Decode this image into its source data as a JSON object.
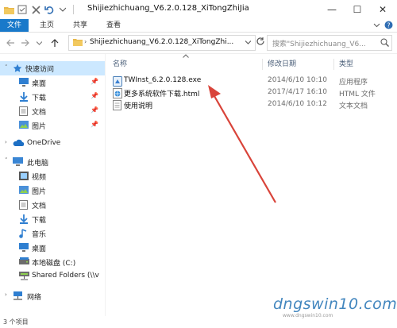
{
  "window": {
    "title": "Shijiezhichuang_V6.2.0.128_XiTongZhiJia",
    "controls": {
      "minimize": "—",
      "maximize": "☐",
      "close": "✕"
    }
  },
  "ribbon": {
    "tabs": [
      "文件",
      "主页",
      "共享",
      "查看"
    ],
    "expand_icon": "chevron-down-icon",
    "help_icon": "help-icon"
  },
  "navigation": {
    "address": "Shijiezhichuang_V6.2.0.128_XiTongZhi...",
    "search_placeholder": "搜索\"Shijiezhichuang_V6...",
    "refresh_icon": "refresh-icon",
    "search_icon": "search-icon"
  },
  "sidebar": {
    "items": [
      {
        "label": "快速访问",
        "icon": "star-icon",
        "pinned": false,
        "selected": true
      },
      {
        "label": "桌面",
        "icon": "desktop-icon",
        "pinned": true
      },
      {
        "label": "下载",
        "icon": "download-icon",
        "pinned": true
      },
      {
        "label": "文档",
        "icon": "document-icon",
        "pinned": true
      },
      {
        "label": "图片",
        "icon": "picture-icon",
        "pinned": true
      },
      {
        "label": "OneDrive",
        "icon": "cloud-icon",
        "pinned": false
      },
      {
        "label": "此电脑",
        "icon": "computer-icon",
        "pinned": false
      },
      {
        "label": "视频",
        "icon": "video-icon",
        "pinned": false
      },
      {
        "label": "图片",
        "icon": "picture-icon",
        "pinned": false
      },
      {
        "label": "文档",
        "icon": "document-icon",
        "pinned": false
      },
      {
        "label": "下载",
        "icon": "download-icon",
        "pinned": false
      },
      {
        "label": "音乐",
        "icon": "music-icon",
        "pinned": false
      },
      {
        "label": "桌面",
        "icon": "desktop-icon",
        "pinned": false
      },
      {
        "label": "本地磁盘 (C:)",
        "icon": "drive-icon",
        "pinned": false
      },
      {
        "label": "Shared Folders (\\\\v",
        "icon": "network-drive-icon",
        "pinned": false
      },
      {
        "label": "网络",
        "icon": "network-icon",
        "pinned": false
      }
    ]
  },
  "file_list": {
    "columns": {
      "name": "名称",
      "date": "修改日期",
      "type": "类型"
    },
    "rows": [
      {
        "name": "TWInst_6.2.0.128.exe",
        "date": "2014/6/10 10:10",
        "type": "应用程序",
        "icon": "exe-icon"
      },
      {
        "name": "更多系统软件下载.html",
        "date": "2017/4/17 16:10",
        "type": "HTML 文件",
        "icon": "html-icon"
      },
      {
        "name": "使用说明",
        "date": "2014/6/10 10:12",
        "type": "文本文档",
        "icon": "text-file-icon"
      }
    ]
  },
  "status_bar": {
    "item_count": "3 个项目"
  },
  "watermark": {
    "text": "dngswin10.com",
    "subtext": "www.dngswin10.com"
  },
  "colors": {
    "accent": "#1979ca",
    "selected": "#cce8ff",
    "arrow": "#d9443a"
  }
}
